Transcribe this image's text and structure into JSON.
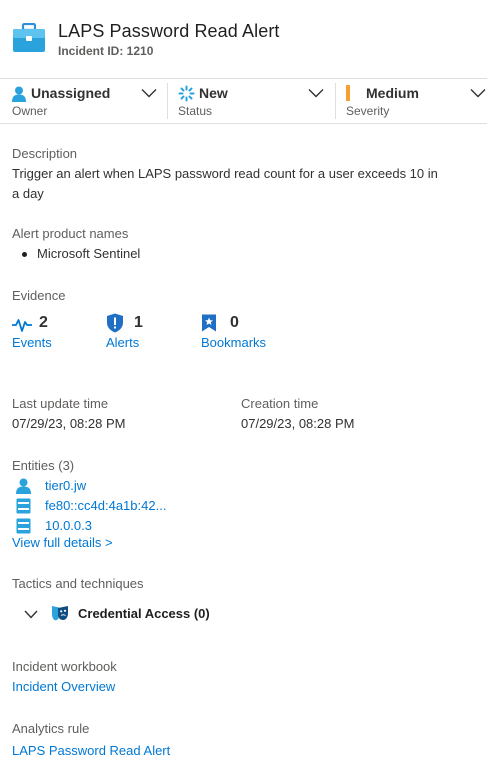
{
  "header": {
    "title": "LAPS Password Read Alert",
    "incident_id": "Incident ID: 1210"
  },
  "owner": {
    "value": "Unassigned",
    "caption": "Owner"
  },
  "status": {
    "value": "New",
    "caption": "Status"
  },
  "severity": {
    "value": "Medium",
    "caption": "Severity",
    "color": "#f7a031"
  },
  "description": {
    "label": "Description",
    "line1": "Trigger an alert when LAPS password read count for a user exceeds 10 in",
    "line2": "a day"
  },
  "alert_products": {
    "label": "Alert product names",
    "items": [
      "Microsoft Sentinel"
    ]
  },
  "evidence": {
    "label": "Evidence",
    "events": {
      "count": "2",
      "label": "Events"
    },
    "alerts": {
      "count": "1",
      "label": "Alerts"
    },
    "bookmarks": {
      "count": "0",
      "label": "Bookmarks"
    }
  },
  "times": {
    "last_update_label": "Last update time",
    "last_update_value": "07/29/23, 08:28 PM",
    "creation_label": "Creation time",
    "creation_value": "07/29/23, 08:28 PM"
  },
  "entities": {
    "label": "Entities (3)",
    "items": [
      "tier0.jw",
      "fe80::cc4d:4a1b:42...",
      "10.0.0.3"
    ],
    "view_details": "View full details >"
  },
  "tactics": {
    "label": "Tactics and techniques",
    "item": "Credential Access (0)"
  },
  "workbook": {
    "label": "Incident workbook",
    "link": "Incident Overview"
  },
  "analytics": {
    "label": "Analytics rule",
    "link": "LAPS Password Read Alert"
  },
  "colors": {
    "accent": "#0078d4",
    "text": "#323130",
    "muted": "#605e5c"
  }
}
